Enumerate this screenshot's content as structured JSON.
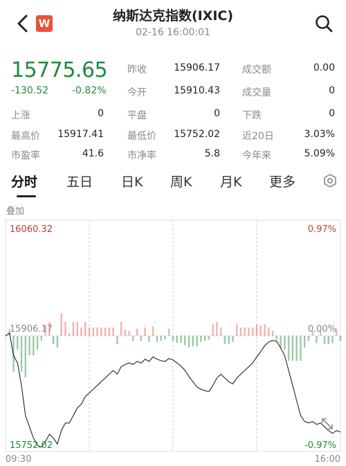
{
  "header": {
    "title": "纳斯达克指数(IXIC)",
    "datetime": "02-16 16:00:01",
    "badge": "W",
    "back_icon": "chevron-left-icon",
    "search_icon": "search-icon"
  },
  "quote": {
    "price": "15775.65",
    "change": "-130.52",
    "change_pct": "-0.82%",
    "prev_close_label": "昨收",
    "prev_close": "15906.17",
    "open_label": "今开",
    "open": "15910.43",
    "turnover_label": "成交额",
    "turnover": "0.00",
    "volume_label": "成交量",
    "volume": "0",
    "up_label": "上涨",
    "up": "0",
    "flat_label": "平盘",
    "flat": "0",
    "down_label": "下跌",
    "down": "0",
    "high_label": "最高价",
    "high": "15917.41",
    "low_label": "最低价",
    "low": "15752.02",
    "d20_label": "近20日",
    "d20": "3.03%",
    "pe_label": "市盈率",
    "pe": "41.6",
    "pb_label": "市净率",
    "pb": "5.8",
    "ytd_label": "今年来",
    "ytd": "5.09%"
  },
  "tabs": [
    "分时",
    "五日",
    "日K",
    "周K",
    "月K",
    "更多"
  ],
  "overlay_label": "叠加",
  "colors": {
    "up": "#e0544a",
    "down": "#1f8a3b",
    "grid": "#cccccc"
  },
  "chart_data": {
    "type": "line",
    "y_max_label": "16060.32",
    "y_mid_label": "15906.17",
    "y_min_label": "15752.02",
    "pct_max_label": "0.97%",
    "pct_mid_label": "0.00%",
    "pct_min_label": "-0.97%",
    "x_start": "09:30",
    "x_end": "16:00",
    "ylim": [
      15752.02,
      16060.32
    ],
    "baseline": 15906.17,
    "price_line": [
      15906,
      15910,
      15880,
      15870,
      15840,
      15800,
      15785,
      15770,
      15760,
      15758,
      15765,
      15775,
      15770,
      15762,
      15780,
      15790,
      15790,
      15800,
      15810,
      15815,
      15825,
      15830,
      15835,
      15840,
      15845,
      15850,
      15855,
      15860,
      15855,
      15865,
      15868,
      15870,
      15868,
      15872,
      15870,
      15875,
      15872,
      15878,
      15875,
      15873,
      15872,
      15876,
      15874,
      15870,
      15866,
      15860,
      15852,
      15845,
      15838,
      15835,
      15833,
      15832,
      15840,
      15850,
      15855,
      15850,
      15845,
      15842,
      15850,
      15855,
      15860,
      15865,
      15870,
      15878,
      15885,
      15893,
      15898,
      15900,
      15899,
      15890,
      15880,
      15860,
      15840,
      15820,
      15800,
      15792,
      15790,
      15792,
      15788,
      15790,
      15785,
      15780,
      15776,
      15780,
      15778
    ]
  }
}
